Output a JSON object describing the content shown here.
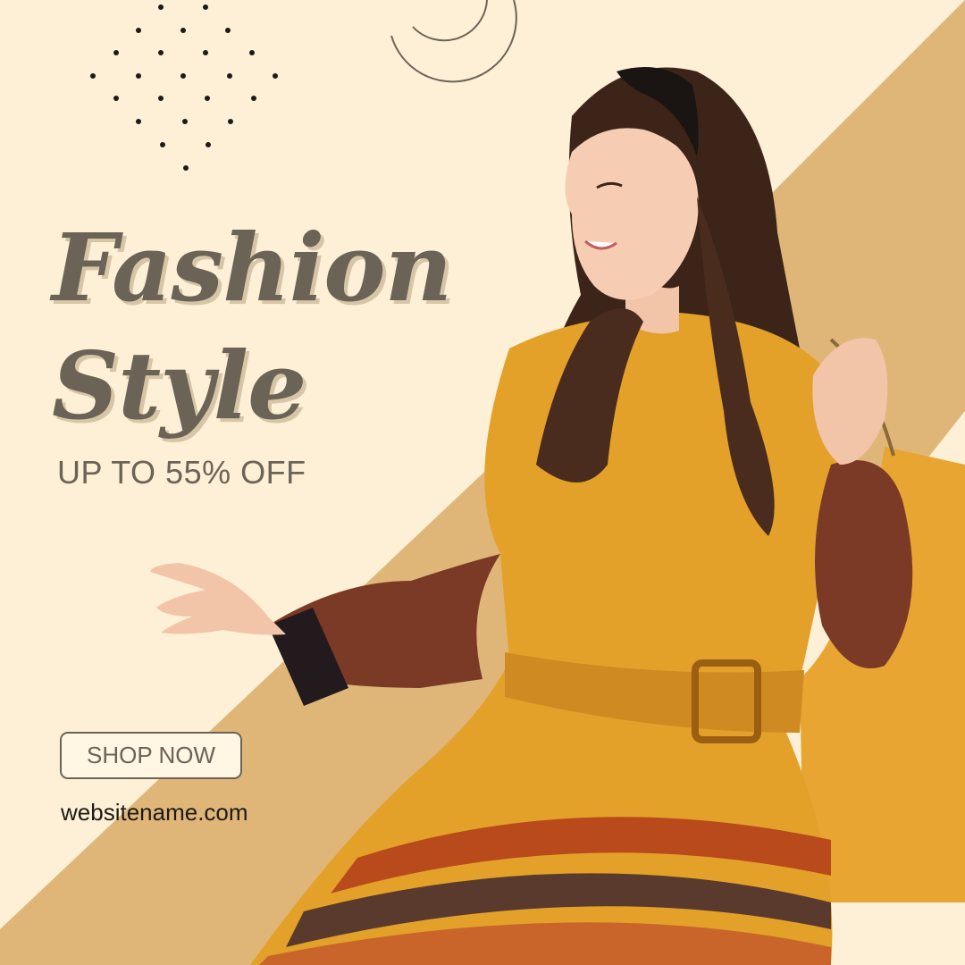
{
  "headline": {
    "line1": "Fashion",
    "line2": "Style"
  },
  "offer": {
    "discount_text": "UP TO 55% OFF"
  },
  "cta": {
    "button_label": "SHOP NOW"
  },
  "footer": {
    "website": "websitename.com"
  },
  "colors": {
    "background": "#fdf0d6",
    "diagonal_band": "#dfb678",
    "text": "#6b6356",
    "text_shadow": "#d6c5a6",
    "dress": "#e3a12a",
    "bag": "#e8a531"
  },
  "decor": {
    "dot_pattern": "dot-grid-decoration",
    "ring": "ring-outline-decoration"
  }
}
